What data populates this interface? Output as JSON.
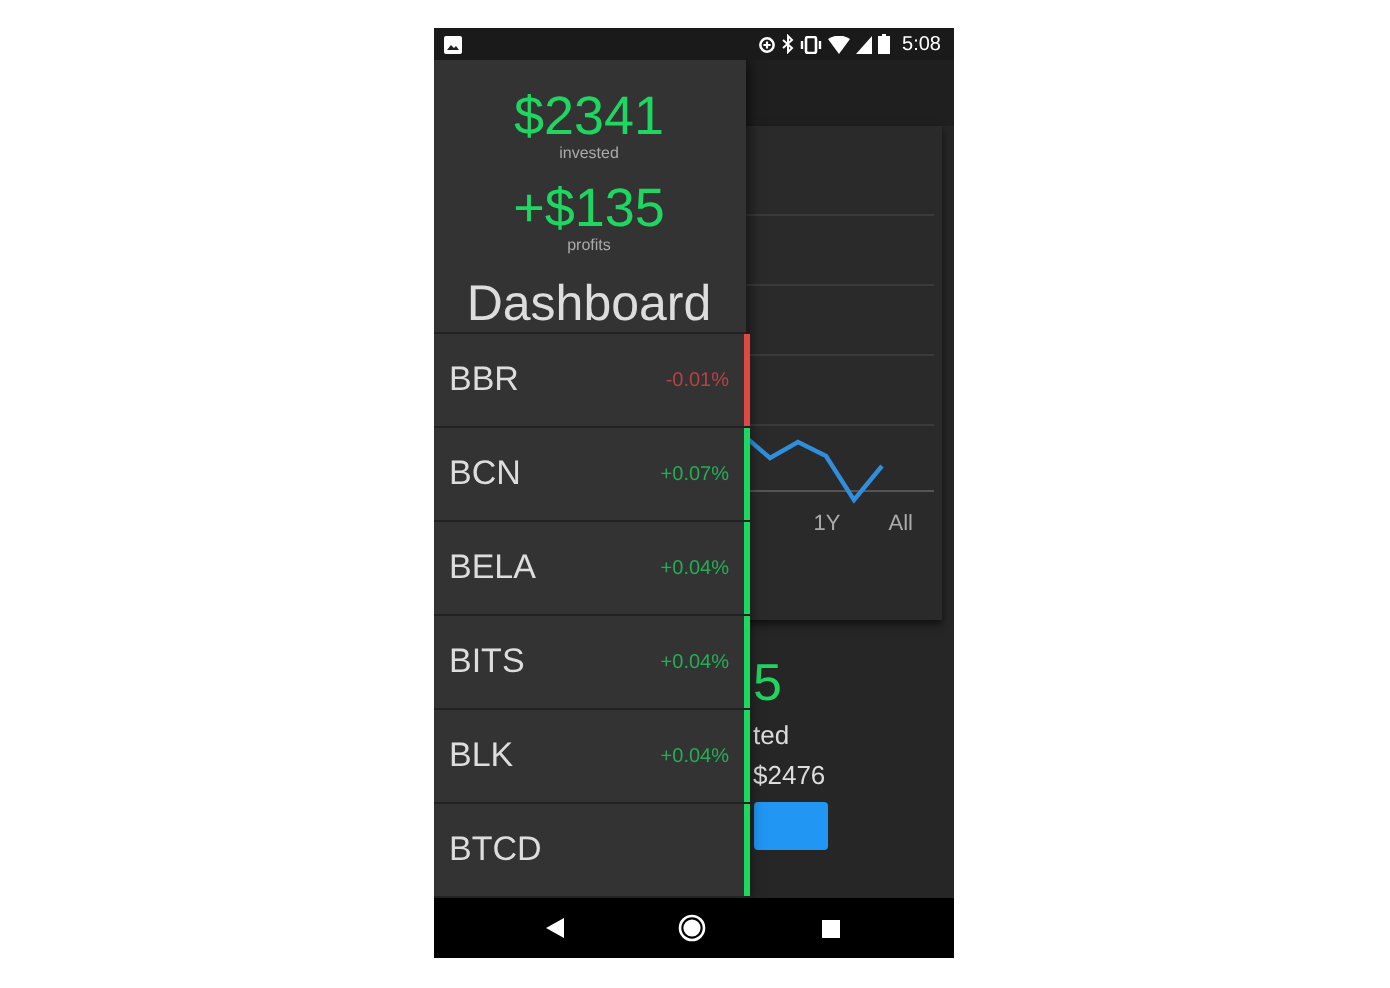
{
  "status_bar": {
    "time": "5:08"
  },
  "background": {
    "chart": {
      "range_tabs": [
        {
          "label": "1Y"
        },
        {
          "label": "All"
        }
      ]
    },
    "summary": {
      "amount": "5",
      "caption": "ted",
      "value": "$2476"
    }
  },
  "drawer": {
    "invested": {
      "amount": "$2341",
      "label": "invested"
    },
    "profits": {
      "amount": "+$135",
      "label": "profits"
    },
    "title": "Dashboard",
    "coins": [
      {
        "name": "BBR",
        "change": "-0.01%",
        "color": "#e04848"
      },
      {
        "name": "BCN",
        "change": "+0.07%",
        "color": "#1ed760"
      },
      {
        "name": "BELA",
        "change": "+0.04%",
        "color": "#1ed760"
      },
      {
        "name": "BITS",
        "change": "+0.04%",
        "color": "#1ed760"
      },
      {
        "name": "BLK",
        "change": "+0.04%",
        "color": "#1ed760"
      },
      {
        "name": "BTCD",
        "color": "#1ed760"
      }
    ]
  }
}
